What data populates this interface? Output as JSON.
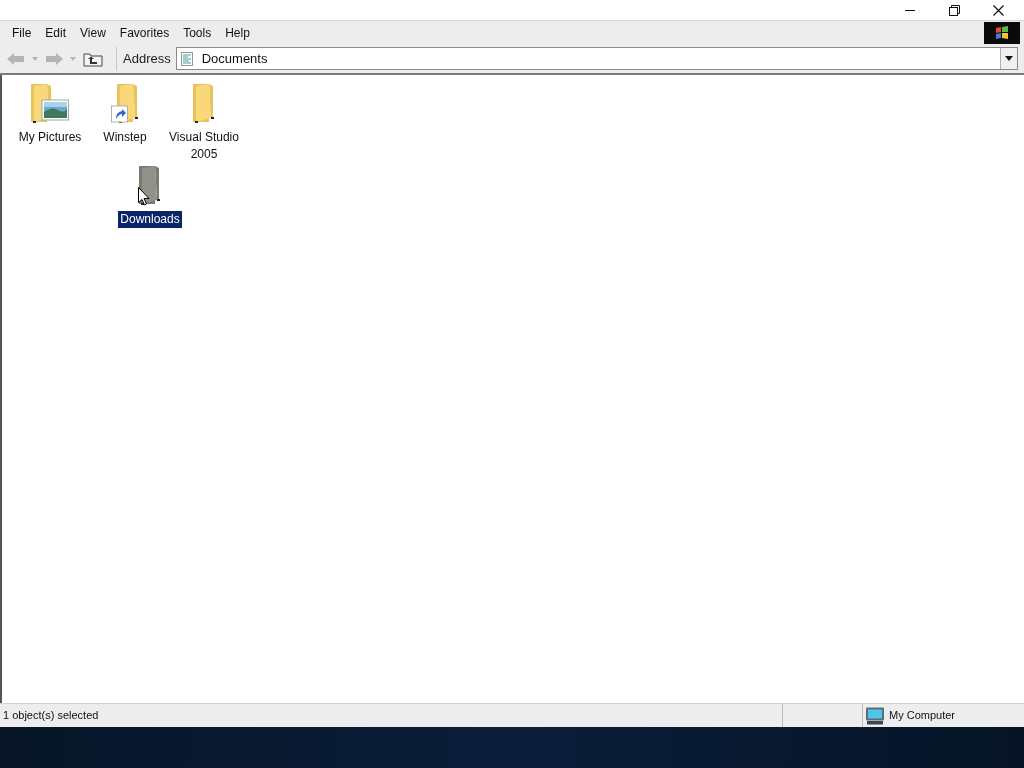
{
  "menu_bar": [
    {
      "label": "File"
    },
    {
      "label": "Edit"
    },
    {
      "label": "View"
    },
    {
      "label": "Favorites"
    },
    {
      "label": "Tools"
    },
    {
      "label": "Help"
    }
  ],
  "toolbar": {
    "back": {
      "disabled": true
    },
    "forward": {
      "disabled": true
    }
  },
  "address_bar": {
    "label": "Address",
    "value": "Documents"
  },
  "items": [
    {
      "label": "My Pictures",
      "kind": "pictures",
      "selected": false
    },
    {
      "label": "Winstep",
      "kind": "shortcut",
      "selected": false
    },
    {
      "label": "Visual Studio 2005",
      "kind": "plain",
      "selected": false
    },
    {
      "label": "Downloads",
      "kind": "plain",
      "selected": true
    }
  ],
  "status_bar": {
    "text": "1 object(s) selected",
    "zone": "My Computer"
  }
}
